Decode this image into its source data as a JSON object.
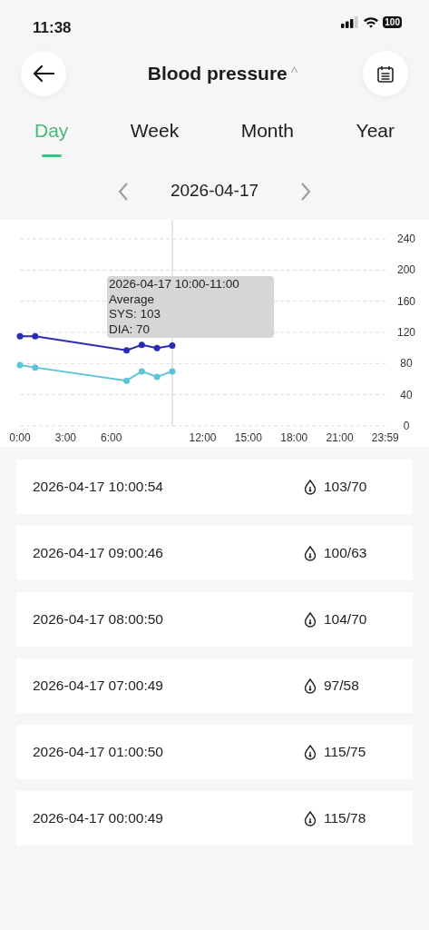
{
  "status_bar": {
    "time": "11:38",
    "battery": "100"
  },
  "header": {
    "title": "Blood pressure",
    "caret": "^"
  },
  "tabs": [
    {
      "label": "Day",
      "selected": true
    },
    {
      "label": "Week",
      "selected": false
    },
    {
      "label": "Month",
      "selected": false
    },
    {
      "label": "Year",
      "selected": false
    }
  ],
  "date_nav": {
    "date": "2026-04-17"
  },
  "chart": {
    "tooltip": [
      "2026-04-17 10:00-11:00",
      "Average",
      "SYS: 103",
      "DIA: 70"
    ],
    "chart_data": {
      "type": "line",
      "x": [
        0,
        1,
        7,
        8,
        9,
        10
      ],
      "series": [
        {
          "color": "#2b2bb5",
          "marker": "o",
          "values": [
            115,
            115,
            97,
            104,
            100,
            103
          ]
        },
        {
          "color": "#5cc4da",
          "marker": "o",
          "values": [
            78,
            75,
            58,
            70,
            63,
            70
          ]
        }
      ],
      "grid": true,
      "ref_lines": [
        {
          "axis": "x",
          "value": 10
        }
      ],
      "xlim": [
        0,
        24
      ],
      "ylim": [
        0,
        240
      ],
      "xticks": [
        {
          "value": 0,
          "label": "0:00"
        },
        {
          "value": 3,
          "label": "3:00"
        },
        {
          "value": 6,
          "label": "6:00"
        },
        {
          "value": 12,
          "label": "12:00"
        },
        {
          "value": 15,
          "label": "15:00"
        },
        {
          "value": 18,
          "label": "18:00"
        },
        {
          "value": 21,
          "label": "21:00"
        },
        {
          "value": 23.9833,
          "label": "23:59"
        }
      ],
      "yticks": [
        0,
        40,
        80,
        120,
        160,
        200,
        240
      ]
    }
  },
  "records": [
    {
      "time": "2026-04-17 10:00:54",
      "value": "103/70"
    },
    {
      "time": "2026-04-17 09:00:46",
      "value": "100/63"
    },
    {
      "time": "2026-04-17 08:00:50",
      "value": "104/70"
    },
    {
      "time": "2026-04-17 07:00:49",
      "value": "97/58"
    },
    {
      "time": "2026-04-17 01:00:50",
      "value": "115/75"
    },
    {
      "time": "2026-04-17 00:00:49",
      "value": "115/78"
    }
  ]
}
